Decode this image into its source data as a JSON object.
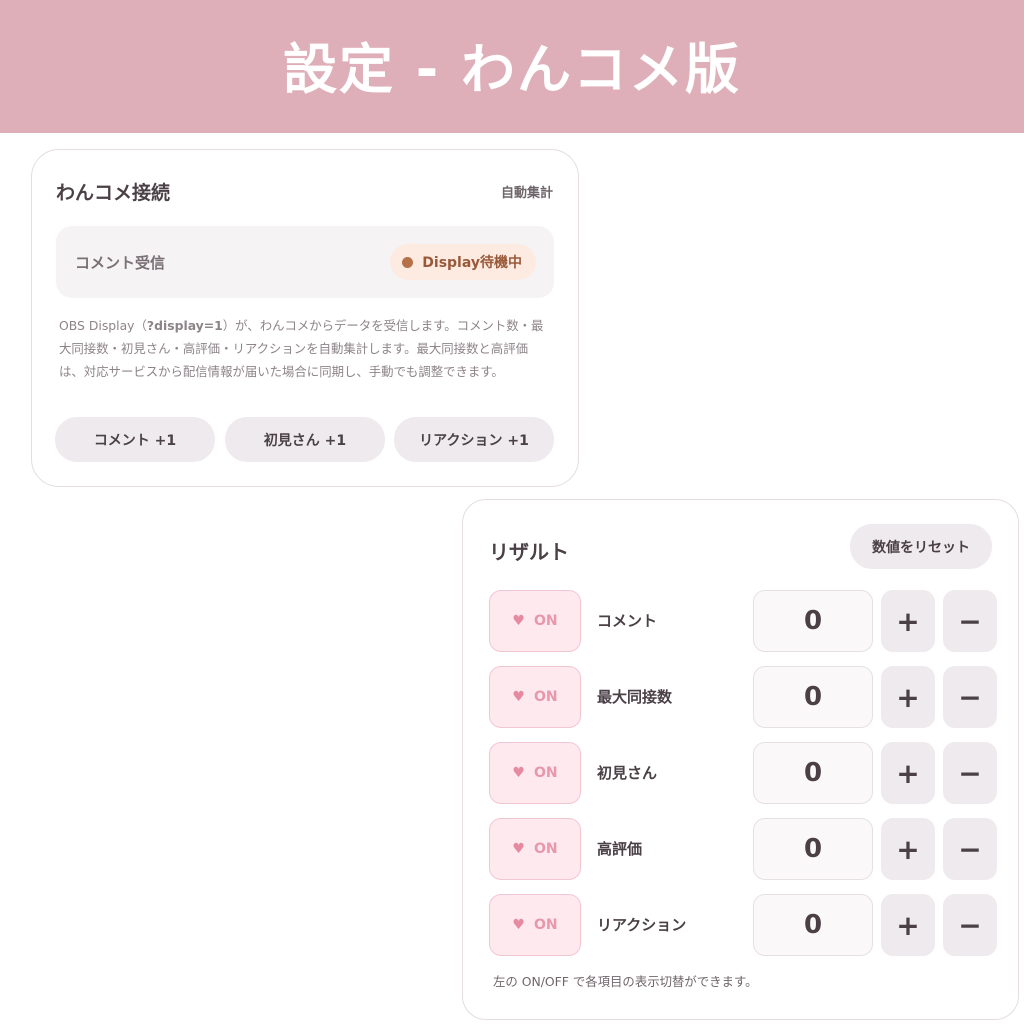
{
  "banner": {
    "title": "設定 - わんコメ版"
  },
  "connection": {
    "title": "わんコメ接続",
    "auto_label": "自動集計",
    "receive_label": "コメント受信",
    "status_text": "Display待機中",
    "description_prefix": "OBS Display（",
    "description_code": "?display=1",
    "description_suffix": "）が、わんコメからデータを受信します。コメント数・最大同接数・初見さん・高評価・リアクションを自動集計します。最大同接数と高評価は、対応サービスから配信情報が届いた場合に同期し、手動でも調整できます。",
    "buttons": [
      {
        "label": "コメント +1"
      },
      {
        "label": "初見さん +1"
      },
      {
        "label": "リアクション +1"
      }
    ]
  },
  "result": {
    "title": "リザルト",
    "reset_label": "数値をリセット",
    "toggle_icon": "heart-icon",
    "plus_label": "+",
    "minus_label": "−",
    "rows": [
      {
        "toggle_label": "ON",
        "label": "コメント",
        "value": "0"
      },
      {
        "toggle_label": "ON",
        "label": "最大同接数",
        "value": "0"
      },
      {
        "toggle_label": "ON",
        "label": "初見さん",
        "value": "0"
      },
      {
        "toggle_label": "ON",
        "label": "高評価",
        "value": "0"
      },
      {
        "toggle_label": "ON",
        "label": "リアクション",
        "value": "0"
      }
    ],
    "note": "左の ON/OFF で各項目の表示切替ができます。"
  },
  "colors": {
    "banner": "#dfafb9",
    "status_dot": "#b57149",
    "toggle_on": "#e898ac"
  }
}
